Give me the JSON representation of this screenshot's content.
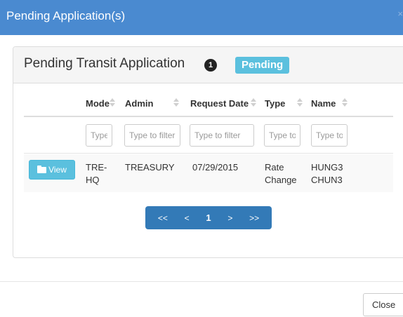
{
  "modal": {
    "title": "Pending Application(s)",
    "close_x": "×",
    "close_button": "Close"
  },
  "panel": {
    "title": "Pending Transit Application",
    "count": "1",
    "status": "Pending"
  },
  "table": {
    "columns": [
      "Mode",
      "Admin",
      "Request Date",
      "Type",
      "Name"
    ],
    "filter_placeholders": [
      "Type to filter",
      "Type to filter",
      "Type to filter",
      "Type to filter",
      "Type to filter"
    ],
    "rows": [
      {
        "action": "View",
        "mode": "TRE-HQ",
        "admin": "TREASURY",
        "request_date": "07/29/2015",
        "type": "Rate Change",
        "name": "HUNG3 CHUN3"
      }
    ]
  },
  "pagination": {
    "first": "<<",
    "prev": "<",
    "current": "1",
    "next": ">",
    "last": ">>"
  },
  "colors": {
    "header": "#4a8ad0",
    "info": "#5bc0de",
    "pager": "#337ab7"
  }
}
